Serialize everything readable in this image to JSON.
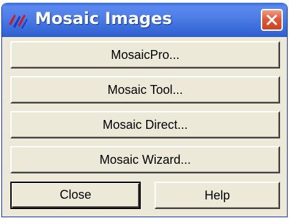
{
  "window": {
    "title": "Mosaic Images",
    "app_icon": "mosaic-app-icon",
    "close_icon": "close-icon"
  },
  "buttons": {
    "mosaicpro": "MosaicPro...",
    "mosaic_tool": "Mosaic Tool...",
    "mosaic_direct": "Mosaic Direct...",
    "mosaic_wizard": "Mosaic Wizard...",
    "close": "Close",
    "help": "Help"
  },
  "colors": {
    "titlebar": "#3a6cdb",
    "dialog_bg": "#ece9d8",
    "close_x_bg": "#e2593a",
    "icon_red": "#d21a1a",
    "icon_blue": "#1a3ac8"
  }
}
